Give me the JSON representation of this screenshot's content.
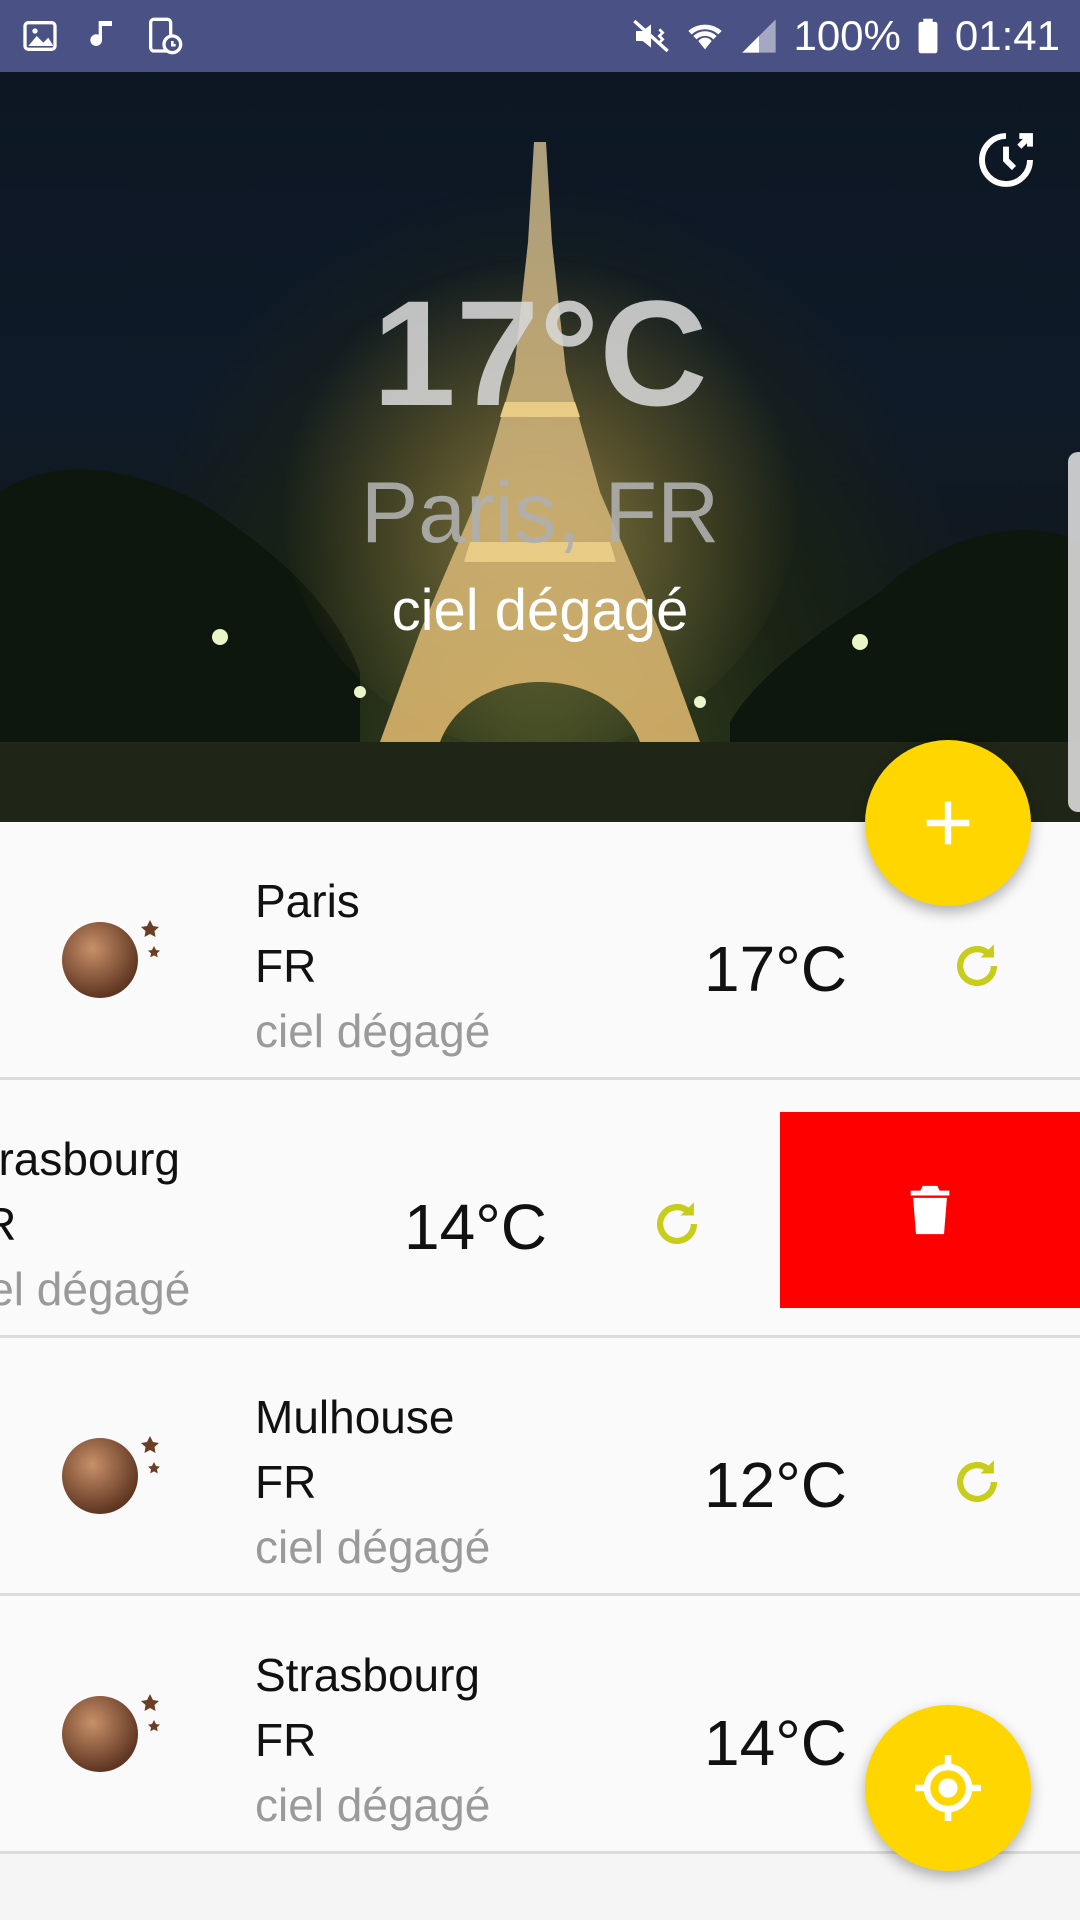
{
  "status_bar": {
    "left_icons": [
      "gallery-icon",
      "music-note-icon",
      "screenshot-icon"
    ],
    "right_icons": [
      "mute-vibrate-icon",
      "wifi-icon",
      "signal-icon",
      "battery-icon"
    ],
    "battery": "100%",
    "time": "01:41"
  },
  "hero": {
    "temperature": "17°C",
    "city": "Paris, FR",
    "description": "ciel dégagé",
    "history_icon": "history-clock-icon"
  },
  "list": {
    "rows": [
      {
        "city": "Paris",
        "country": "FR",
        "description": "ciel dégagé",
        "temp": "17°C",
        "weather_icon": "clear-night-moon-icon"
      },
      {
        "city": "Strasbourg",
        "country": "FR",
        "description": "ciel dégagé",
        "temp": "14°C",
        "weather_icon": "clear-night-moon-icon",
        "swiped": true
      },
      {
        "city": "Mulhouse",
        "country": "FR",
        "description": "ciel dégagé",
        "temp": "12°C",
        "weather_icon": "clear-night-moon-icon"
      },
      {
        "city": "Strasbourg",
        "country": "FR",
        "description": "ciel dégagé",
        "temp": "14°C",
        "weather_icon": "clear-night-moon-icon"
      }
    ]
  },
  "actions": {
    "add_icon": "plus-icon",
    "location_icon": "my-location-icon",
    "delete_icon": "trash-icon"
  },
  "colors": {
    "status_bar": "#4a5184",
    "accent": "#ffd600",
    "refresh": "#c8cc1a",
    "delete": "#ff0000"
  }
}
